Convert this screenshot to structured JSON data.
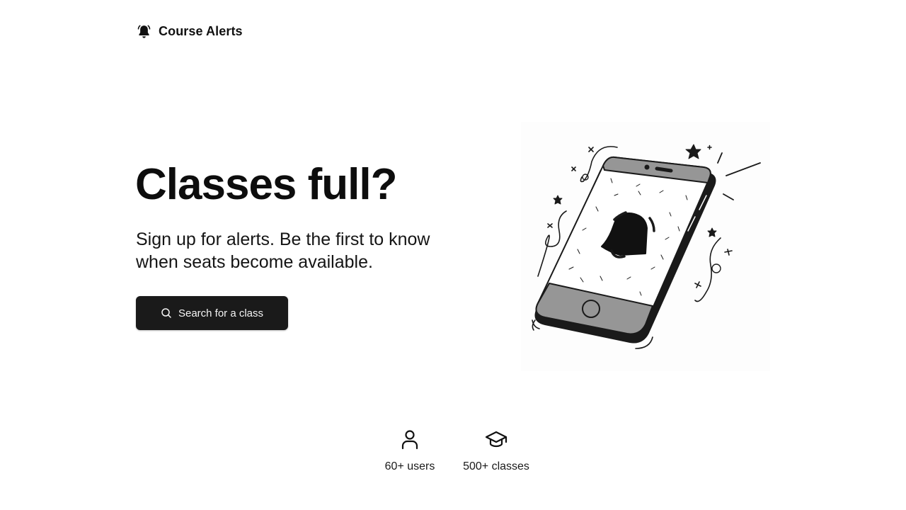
{
  "header": {
    "brand_name": "Course Alerts",
    "brand_icon": "bell-ringing-icon"
  },
  "hero": {
    "title": "Classes full?",
    "subtitle": "Sign up for alerts. Be the first to know when seats become available.",
    "cta_label": "Search for a class",
    "cta_icon": "search-icon",
    "illustration": "phone-bell-illustration"
  },
  "stats": [
    {
      "icon": "user-icon",
      "label": "60+ users"
    },
    {
      "icon": "graduation-cap-icon",
      "label": "500+ classes"
    }
  ],
  "colors": {
    "background": "#ffffff",
    "text": "#111111",
    "button": "#1a1a1a",
    "button_text": "#f4f4f4"
  }
}
